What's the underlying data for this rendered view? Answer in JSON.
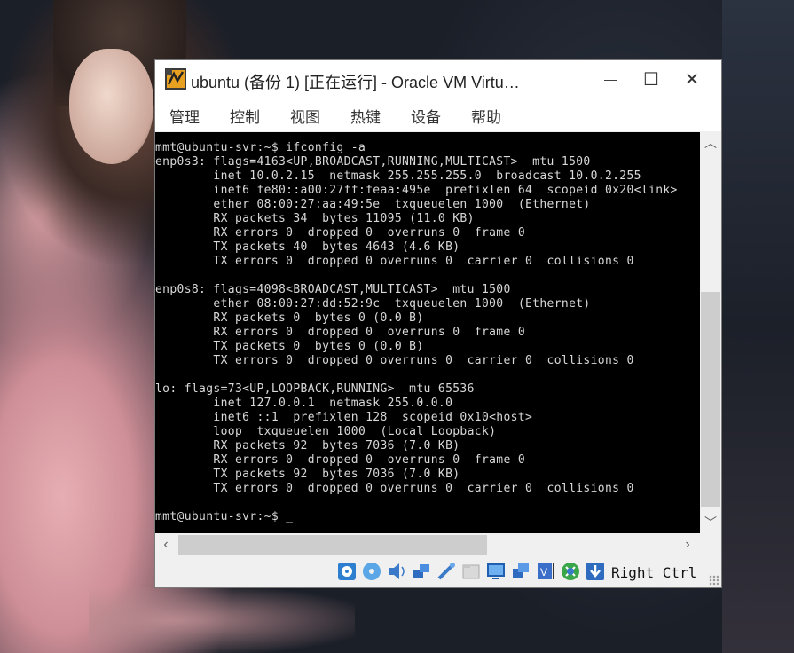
{
  "window": {
    "title": "ubuntu (备份 1) [正在运行] - Oracle VM Virtu…",
    "minimize_glyph": "—",
    "maximize_glyph": "☐",
    "close_glyph": "✕"
  },
  "menu": [
    "管理",
    "控制",
    "视图",
    "热键",
    "设备",
    "帮助"
  ],
  "terminal": {
    "lines": [
      "mmt@ubuntu-svr:~$ ifconfig -a",
      "enp0s3: flags=4163<UP,BROADCAST,RUNNING,MULTICAST>  mtu 1500",
      "        inet 10.0.2.15  netmask 255.255.255.0  broadcast 10.0.2.255",
      "        inet6 fe80::a00:27ff:feaa:495e  prefixlen 64  scopeid 0x20<link>",
      "        ether 08:00:27:aa:49:5e  txqueuelen 1000  (Ethernet)",
      "        RX packets 34  bytes 11095 (11.0 KB)",
      "        RX errors 0  dropped 0  overruns 0  frame 0",
      "        TX packets 40  bytes 4643 (4.6 KB)",
      "        TX errors 0  dropped 0 overruns 0  carrier 0  collisions 0",
      "",
      "enp0s8: flags=4098<BROADCAST,MULTICAST>  mtu 1500",
      "        ether 08:00:27:dd:52:9c  txqueuelen 1000  (Ethernet)",
      "        RX packets 0  bytes 0 (0.0 B)",
      "        RX errors 0  dropped 0  overruns 0  frame 0",
      "        TX packets 0  bytes 0 (0.0 B)",
      "        TX errors 0  dropped 0 overruns 0  carrier 0  collisions 0",
      "",
      "lo: flags=73<UP,LOOPBACK,RUNNING>  mtu 65536",
      "        inet 127.0.0.1  netmask 255.0.0.0",
      "        inet6 ::1  prefixlen 128  scopeid 0x10<host>",
      "        loop  txqueuelen 1000  (Local Loopback)",
      "        RX packets 92  bytes 7036 (7.0 KB)",
      "        RX errors 0  dropped 0  overruns 0  frame 0",
      "        TX packets 92  bytes 7036 (7.0 KB)",
      "        TX errors 0  dropped 0 overruns 0  carrier 0  collisions 0",
      "",
      "mmt@ubuntu-svr:~$ _"
    ]
  },
  "statusbar": {
    "icons": [
      "hard-disk-icon",
      "optical-drive-icon",
      "audio-icon",
      "network-icon",
      "usb-icon",
      "shared-folders-icon",
      "display-icon",
      "video-capture-icon",
      "virtualization-icon",
      "mouse-integration-icon",
      "keyboard-capture-icon"
    ],
    "host_key": "Right Ctrl"
  },
  "colors": {
    "terminal_bg": "#000000",
    "terminal_fg": "#d8d8d8",
    "chrome_bg": "#f0f0f0"
  }
}
